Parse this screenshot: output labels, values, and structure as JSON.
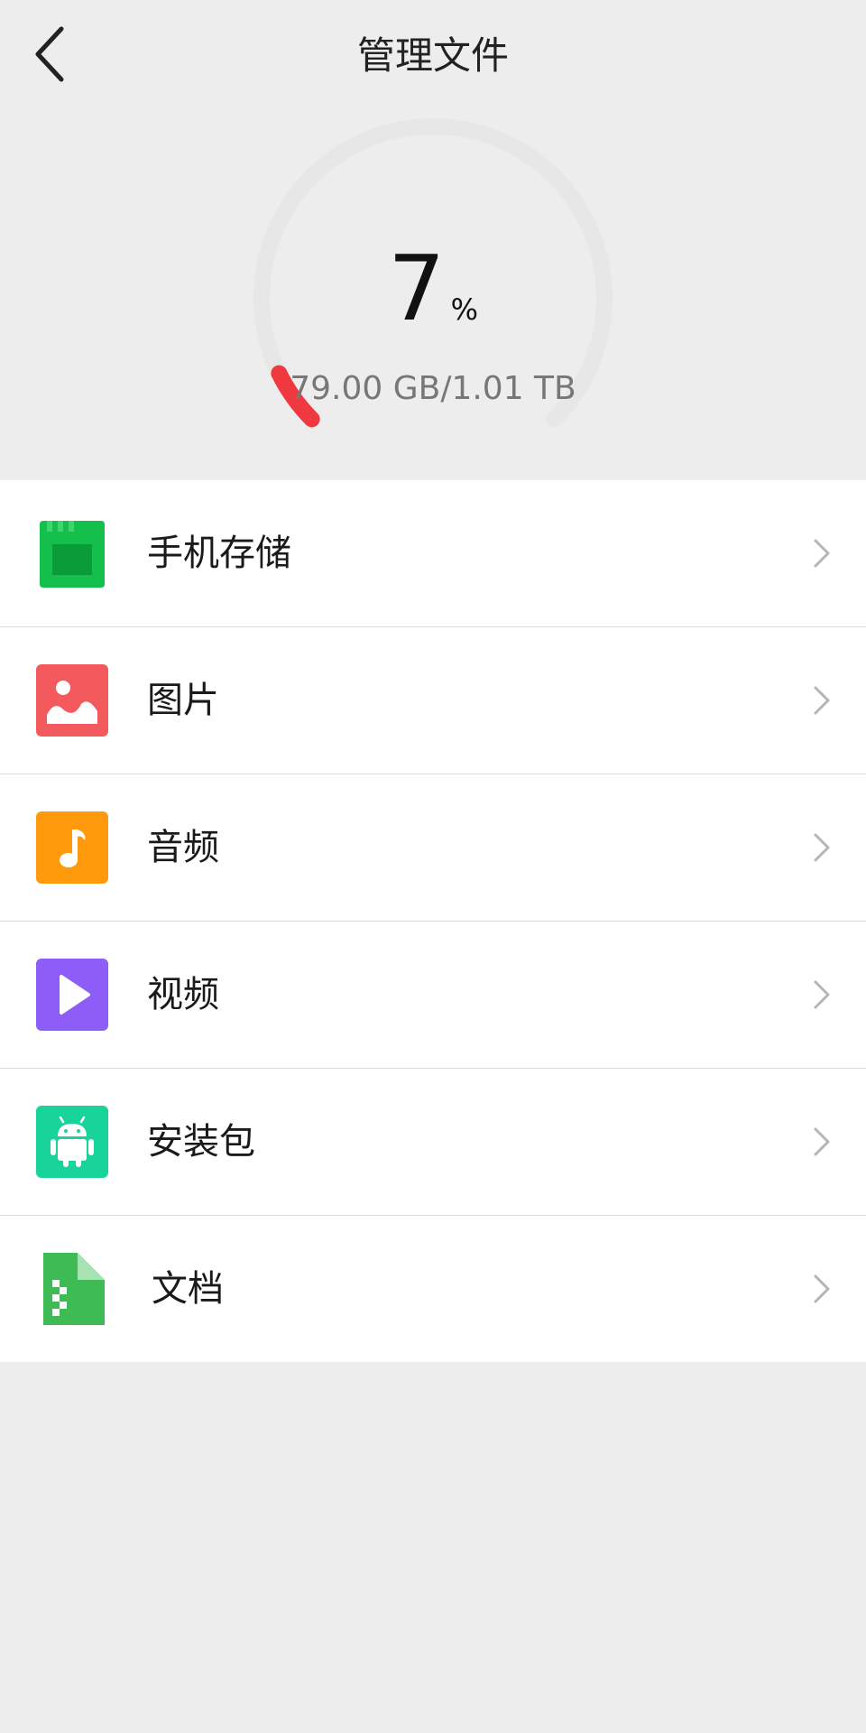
{
  "header": {
    "title": "管理文件"
  },
  "storage": {
    "percent": 7,
    "percent_label": "7",
    "percent_unit": "%",
    "usage_text": "79.00 GB/1.01 TB",
    "track_color": "#e7e7e7",
    "used_color": "#f0393f"
  },
  "items": [
    {
      "label": "手机存储",
      "icon": "sd-card-icon",
      "color": "#14c04b"
    },
    {
      "label": "图片",
      "icon": "image-icon",
      "color": "#f35a5e"
    },
    {
      "label": "音频",
      "icon": "music-note-icon",
      "color": "#ff9a0d"
    },
    {
      "label": "视频",
      "icon": "play-icon",
      "color": "#8e5cf6"
    },
    {
      "label": "安装包",
      "icon": "android-icon",
      "color": "#19d49a"
    },
    {
      "label": "文档",
      "icon": "document-icon",
      "color": "#3fbb55"
    }
  ]
}
